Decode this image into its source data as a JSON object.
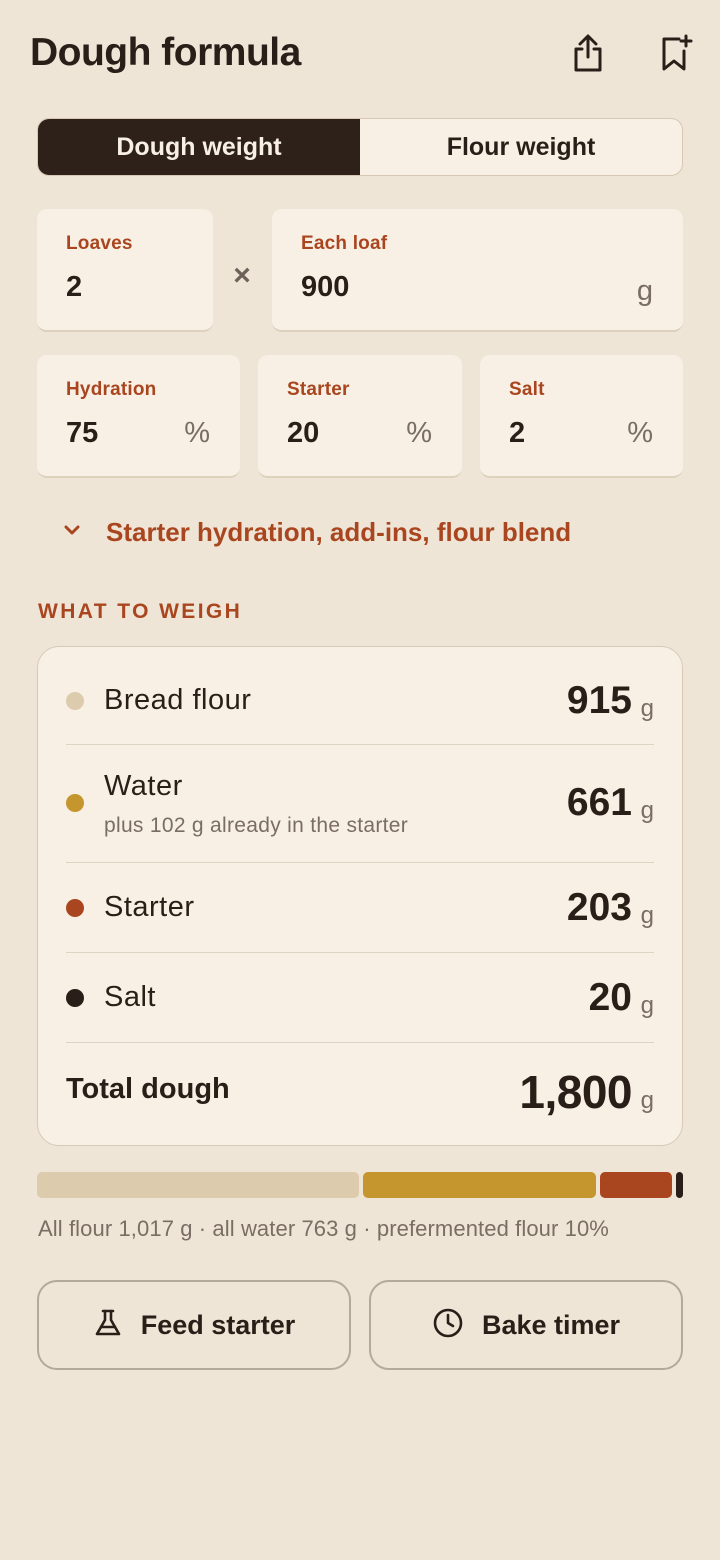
{
  "header": {
    "title": "Dough formula",
    "share_icon": "share-icon",
    "bookmark_icon": "bookmark-add-icon"
  },
  "mode_toggle": {
    "options": [
      "Dough weight",
      "Flour weight"
    ],
    "selected": "Dough weight"
  },
  "inputs": {
    "loaves": {
      "label": "Loaves",
      "value": "2"
    },
    "multiply_symbol": "×",
    "each_loaf": {
      "label": "Each loaf",
      "value": "900",
      "unit": "g"
    },
    "hydration": {
      "label": "Hydration",
      "value": "75",
      "unit": "%"
    },
    "starter": {
      "label": "Starter",
      "value": "20",
      "unit": "%"
    },
    "salt": {
      "label": "Salt",
      "value": "2",
      "unit": "%"
    }
  },
  "advanced": {
    "label": "Starter hydration, add-ins, flour blend",
    "expanded": false
  },
  "weigh": {
    "section_title": "WHAT TO WEIGH",
    "items": [
      {
        "name": "Bread flour",
        "value": "915",
        "unit": "g",
        "color": "#ddcbad"
      },
      {
        "name": "Water",
        "sub": "plus 102 g already in the starter",
        "value": "661",
        "unit": "g",
        "color": "#c6962e"
      },
      {
        "name": "Starter",
        "value": "203",
        "unit": "g",
        "color": "#a9461f"
      },
      {
        "name": "Salt",
        "value": "20",
        "unit": "g",
        "color": "#2a1f18"
      }
    ],
    "total": {
      "name": "Total dough",
      "value": "1,800",
      "unit": "g"
    }
  },
  "composition": {
    "segments": [
      {
        "name": "Bread flour",
        "grams": 915,
        "color": "#ddcbad"
      },
      {
        "name": "Water",
        "grams": 661,
        "color": "#c6962e"
      },
      {
        "name": "Starter",
        "grams": 203,
        "color": "#a9461f"
      },
      {
        "name": "Salt",
        "grams": 20,
        "color": "#2a1f18"
      }
    ],
    "caption": "All flour 1,017 g · all water 763 g · prefermented flour 10%"
  },
  "actions": {
    "feed_starter": {
      "label": "Feed starter",
      "icon": "flask-icon"
    },
    "bake_timer": {
      "label": "Bake timer",
      "icon": "clock-icon"
    }
  }
}
